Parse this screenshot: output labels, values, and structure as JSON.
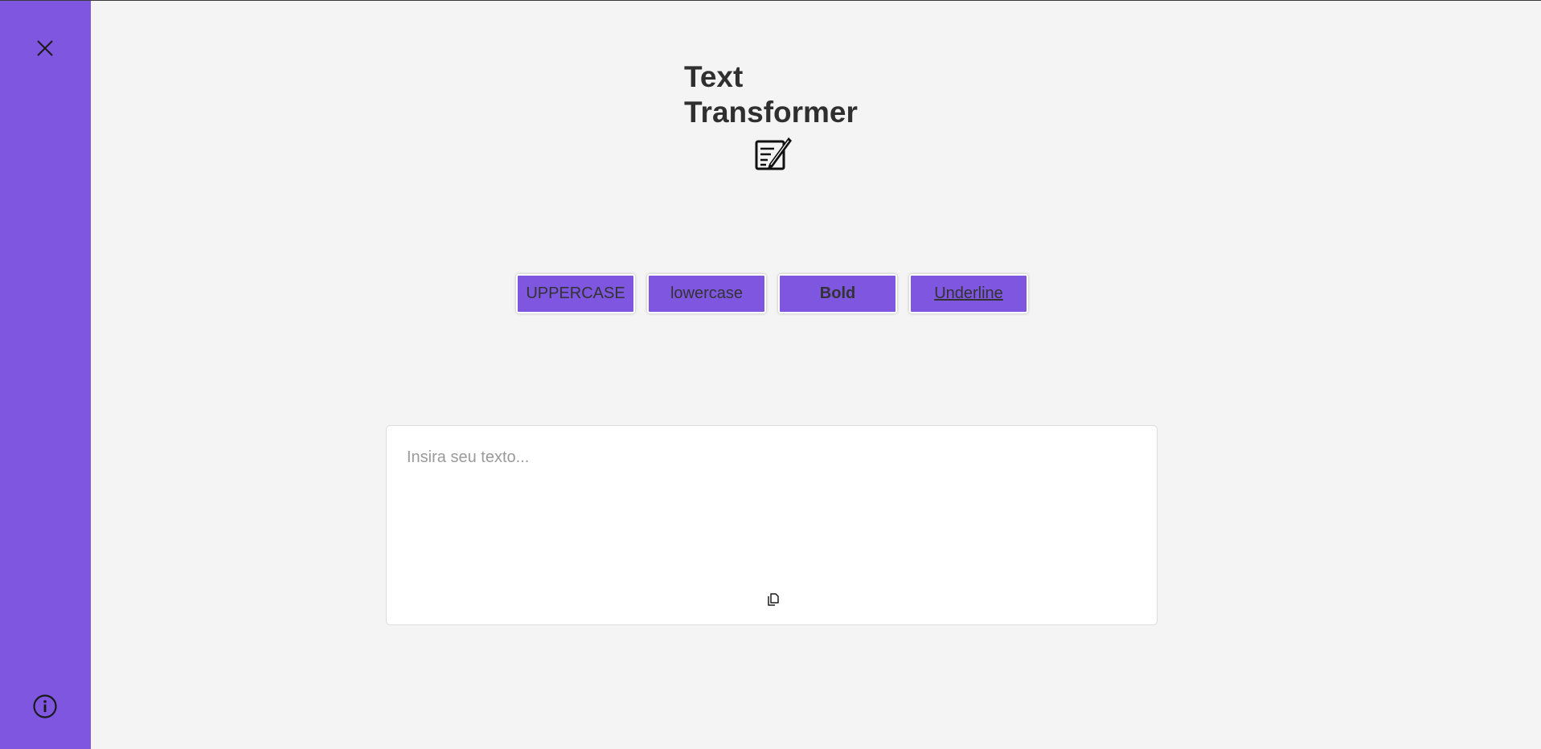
{
  "sidebar": {
    "color": "#7f56e0",
    "close_icon": "close-icon",
    "info_icon": "info-icon"
  },
  "header": {
    "title": "Text Transformer",
    "icon": "edit-document-icon"
  },
  "toolbar": {
    "uppercase_label": "UPPERCASE",
    "lowercase_label": "lowercase",
    "bold_label": "Bold",
    "underline_label": "Underline"
  },
  "editor": {
    "placeholder": "Insira seu texto...",
    "value": "",
    "copy_icon": "copy-icon"
  },
  "colors": {
    "accent": "#7f56e0",
    "background": "#f4f4f4",
    "text": "#2f2f2f"
  }
}
